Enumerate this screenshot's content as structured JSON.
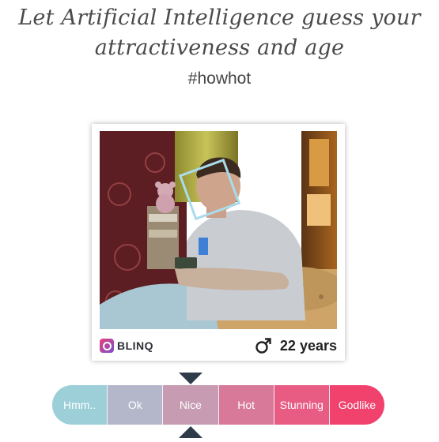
{
  "header": {
    "headline_line1": "Let Artificial Intelligence guess your",
    "headline_line2": "attractiveness and age",
    "hashtag": "#howhot"
  },
  "card": {
    "photo_alt": "Uploaded photo with detected face",
    "brand": "BLINQ",
    "gender_icon": "male-icon",
    "age": "22 years"
  },
  "rating_scale": {
    "selected_index": 2,
    "levels": [
      {
        "label": "Hmm..",
        "color": "#9ccfd8"
      },
      {
        "label": "Ok",
        "color": "#b3b7c9"
      },
      {
        "label": "Nice",
        "color": "#c79bb1"
      },
      {
        "label": "Hot",
        "color": "#d8799a"
      },
      {
        "label": "Stunning",
        "color": "#e85c84"
      },
      {
        "label": "Godlike",
        "color": "#f0426d"
      }
    ]
  },
  "colors": {
    "pointer": "#2f3b48",
    "face_box": "#a9dceb"
  }
}
